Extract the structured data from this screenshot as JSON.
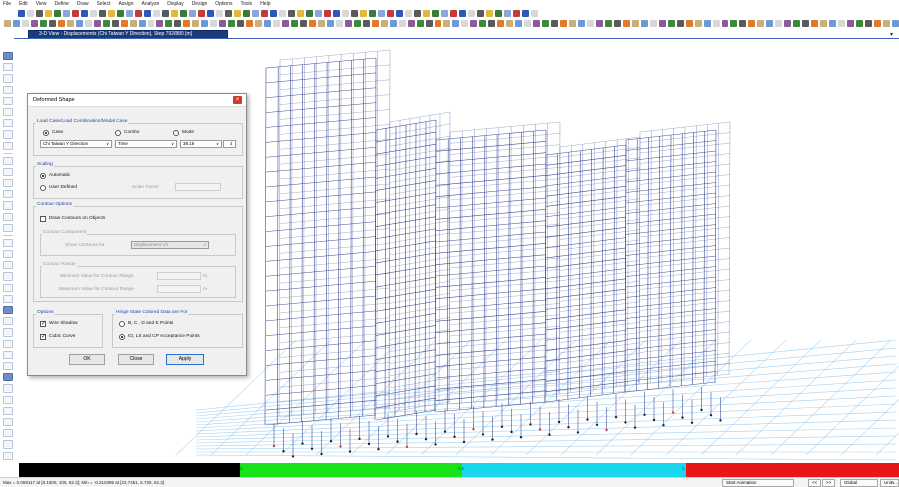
{
  "menu": [
    "File",
    "Edit",
    "View",
    "Define",
    "Draw",
    "Select",
    "Assign",
    "Analyze",
    "Display",
    "Design",
    "Options",
    "Tools",
    "Help"
  ],
  "view_tab": {
    "title": "3-D View  -  Displacements (Chi Taiwan Y Direction), Step 792/880  [m]"
  },
  "dialog": {
    "title": "Deformed Shape",
    "load_group_label": "Load Case/Load Combination/Modal Case",
    "radio_case": "Case",
    "radio_combo": "Combo",
    "radio_mode": "Mode",
    "case_value": "Chi Taiwan Y Direction",
    "time_value": "Time",
    "step_value": "38.16",
    "scaling_label": "Scaling",
    "automatic": "Automatic",
    "user_defined": "User Defined",
    "scale_factor": "Scale Factor",
    "contour_options_label": "Contour Options",
    "draw_contours": "Draw Contours on Objects",
    "contour_component_label": "Contour Component",
    "show_contours_for": "Show Contours for",
    "contour_component_value": "Displacement UY",
    "contour_range_label": "Contour Range",
    "min_label": "Minimum Value for Contour Range",
    "max_label": "Maximum Value for Contour Range",
    "unit_m1": "m",
    "unit_m2": "m",
    "options_label": "Options",
    "wire_shadow": "Wire Shadow",
    "cubic_curve": "Cubic Curve",
    "hinge_label": "Hinge State Colored Data are For",
    "hinge_bcde": "B, C , D and E Points",
    "hinge_io": "IO, LS and CP Acceptance Points",
    "ok": "OK",
    "close": "Close",
    "apply": "Apply"
  },
  "color_scale": {
    "labels": [
      "0",
      "2.5",
      "5"
    ],
    "colors": [
      "#000000",
      "#18e318",
      "#17d7ee",
      "#e81616"
    ]
  },
  "status": {
    "text": "Max = 0.059117 at [6.1500, 100, 62.3];  Min = -0.210395 at [23.7451, 5.725, 62.3]",
    "start_animation": "Start Animation",
    "nav_prev": "<<",
    "nav_next": ">>",
    "coord_system": "Global",
    "units": "Units..."
  },
  "colors": {
    "structure": "#2f3e8e",
    "grid": "#8fc6ee",
    "titlebar": "#1b3a7a",
    "close": "#d23a2f"
  }
}
